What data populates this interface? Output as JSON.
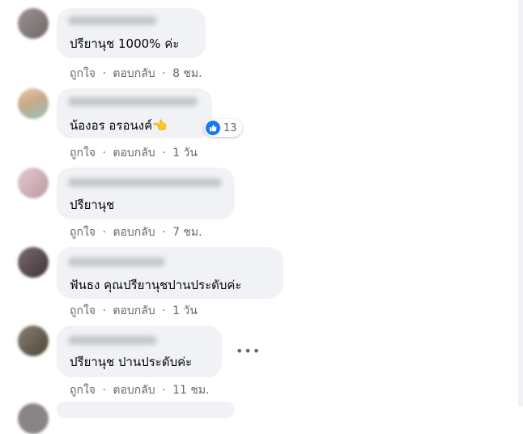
{
  "actions": {
    "like": "ถูกใจ",
    "reply": "ตอบกลับ",
    "separator": "·"
  },
  "comments": [
    {
      "text": "ปรียานุช 1000% ค่ะ",
      "time": "8 ชม."
    },
    {
      "text": "น้องอร อรอนงค์👈",
      "time": "1 วัน",
      "reaction_count": "13",
      "reaction_icon": "like-icon"
    },
    {
      "text": "ปรียานุช",
      "time": "7 ชม."
    },
    {
      "text": "ฟันธง คุณปรียานุชปานประดับค่ะ",
      "time": "1 วัน"
    },
    {
      "text": "ปรียานุช ปานประดับค่ะ",
      "time": "11 ชม.",
      "more_icon": "more-options-icon"
    }
  ],
  "colors": {
    "bubble": "#f0f2f5",
    "secondary_text": "#65676b",
    "like_blue": "#1877f2"
  }
}
